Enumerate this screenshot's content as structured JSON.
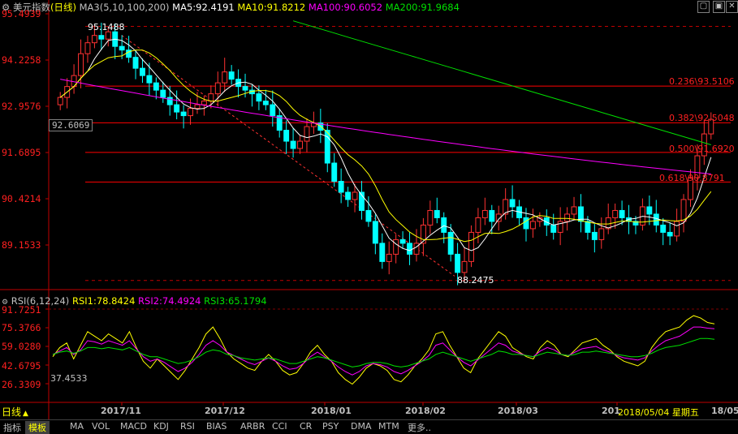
{
  "header": {
    "name": "美元指数",
    "period": "(日线)",
    "ma_label": "MA3(5,10,100,200)",
    "ma5": "MA5:92.4191",
    "ma10": "MA10:91.8212",
    "ma100": "MA100:90.6052",
    "ma200": "MA200:91.9684"
  },
  "rsi_header": {
    "label": "RSI(6,12,24)",
    "rsi1": "RSI1:78.8424",
    "rsi2": "RSI2:74.4924",
    "rsi3": "RSI3:65.1794"
  },
  "price_axis": [
    "95.4939",
    "94.2258",
    "92.9576",
    "91.6895",
    "90.4214",
    "89.1533"
  ],
  "rsi_axis": [
    "91.7251",
    "75.3766",
    "59.0280",
    "42.6795",
    "26.3309"
  ],
  "current_price_tag": "92.6069",
  "rsi_current_tag": "37.4533",
  "high_label": "95.1488",
  "low_label": "88.2475",
  "fib_labels": [
    "0.236\\93.5106",
    "0.382\\92.5048",
    "0.500\\91.6920",
    "0.618\\90.8791"
  ],
  "x_axis": [
    "2017/11",
    "2017/12",
    "2018/01",
    "2018/02",
    "2018/03",
    "2018/05/04 星期五"
  ],
  "x_axis_extra": [
    "201",
    "18/05"
  ],
  "bottom_bar": {
    "period_btn": "日线",
    "tabs": [
      "指标",
      "模板",
      "MA",
      "VOL",
      "MACD",
      "KDJ",
      "RSI",
      "BIAS",
      "ARBR",
      "CCI",
      "CR",
      "PSY",
      "DMA",
      "MTM",
      "更多.."
    ]
  },
  "colors": {
    "up": "#ff3232",
    "down": "#00ffff",
    "ma5": "#ffffff",
    "ma10": "#ffff00",
    "ma100": "#ff00ff",
    "ma200": "#00e000",
    "fib": "#ff0000"
  },
  "chart_data": [
    {
      "type": "candlestick",
      "title": "美元指数 (日线)",
      "x_ticks": [
        "2017/11",
        "2017/12",
        "2018/01",
        "2018/02",
        "2018/03"
      ],
      "ylim": [
        88.0,
        95.8
      ],
      "y_ticks": [
        95.4939,
        94.2258,
        92.9576,
        91.6895,
        90.4214,
        89.1533
      ],
      "fib_levels": [
        {
          "ratio": 0.236,
          "value": 93.5106
        },
        {
          "ratio": 0.382,
          "value": 92.5048
        },
        {
          "ratio": 0.5,
          "value": 91.692
        },
        {
          "ratio": 0.618,
          "value": 90.8791
        }
      ],
      "high": 95.1488,
      "low": 88.2475,
      "close_approx": [
        93.2,
        93.5,
        93.8,
        94.4,
        94.7,
        94.9,
        94.8,
        95.0,
        94.6,
        94.5,
        94.3,
        94.0,
        93.8,
        93.6,
        93.4,
        93.2,
        93.0,
        92.8,
        92.7,
        92.9,
        93.0,
        93.1,
        93.3,
        93.6,
        93.9,
        93.7,
        93.5,
        93.4,
        93.3,
        93.1,
        93.0,
        92.7,
        92.3,
        92.0,
        91.8,
        92.0,
        92.4,
        92.5,
        92.3,
        91.4,
        90.9,
        90.6,
        90.4,
        90.6,
        90.1,
        89.8,
        89.2,
        88.7,
        88.9,
        89.3,
        89.2,
        88.9,
        89.2,
        89.7,
        90.1,
        89.9,
        89.5,
        88.9,
        88.4,
        88.7,
        89.5,
        89.9,
        90.1,
        89.8,
        90.0,
        90.4,
        90.2,
        89.9,
        89.6,
        89.8,
        89.9,
        89.7,
        89.5,
        89.8,
        90.0,
        90.2,
        89.8,
        89.5,
        89.3,
        89.6,
        89.9,
        90.1,
        89.9,
        89.8,
        89.7,
        90.2,
        90.0,
        89.7,
        89.5,
        89.4,
        89.8,
        90.4,
        91.0,
        91.6,
        92.2,
        92.6
      ],
      "series": [
        {
          "name": "MA5",
          "last": 92.4191
        },
        {
          "name": "MA10",
          "last": 91.8212
        },
        {
          "name": "MA100",
          "last": 90.6052
        },
        {
          "name": "MA200",
          "last": 91.9684
        }
      ]
    },
    {
      "type": "line",
      "title": "RSI(6,12,24)",
      "ylim": [
        20,
        95
      ],
      "y_ticks": [
        91.7251,
        75.3766,
        59.028,
        42.6795,
        26.3309
      ],
      "series": [
        {
          "name": "RSI1",
          "last": 78.8424,
          "values": [
            50,
            58,
            62,
            48,
            60,
            72,
            68,
            64,
            70,
            66,
            62,
            72,
            58,
            46,
            40,
            48,
            42,
            36,
            30,
            38,
            48,
            58,
            70,
            76,
            66,
            54,
            48,
            44,
            40,
            38,
            46,
            52,
            46,
            38,
            34,
            36,
            44,
            54,
            60,
            52,
            46,
            36,
            30,
            26,
            32,
            40,
            44,
            42,
            38,
            30,
            28,
            34,
            42,
            48,
            56,
            70,
            72,
            60,
            50,
            40,
            36,
            48,
            56,
            64,
            72,
            68,
            58,
            54,
            50,
            48,
            58,
            64,
            60,
            52,
            50,
            56,
            62,
            64,
            66,
            60,
            56,
            50,
            46,
            44,
            42,
            46,
            58,
            66,
            72,
            74,
            76,
            82,
            86,
            84,
            80,
            78.8
          ]
        },
        {
          "name": "RSI2",
          "last": 74.4924,
          "values": [
            52,
            55,
            58,
            52,
            56,
            64,
            63,
            61,
            64,
            62,
            60,
            64,
            57,
            50,
            46,
            48,
            45,
            41,
            37,
            40,
            45,
            52,
            60,
            64,
            60,
            54,
            51,
            48,
            45,
            43,
            46,
            49,
            46,
            42,
            39,
            40,
            44,
            50,
            54,
            50,
            46,
            41,
            37,
            34,
            37,
            42,
            44,
            43,
            41,
            37,
            35,
            38,
            42,
            46,
            51,
            60,
            62,
            56,
            50,
            45,
            42,
            47,
            52,
            57,
            62,
            60,
            55,
            53,
            51,
            50,
            55,
            58,
            56,
            52,
            51,
            54,
            57,
            58,
            59,
            56,
            54,
            51,
            49,
            48,
            47,
            49,
            55,
            60,
            64,
            66,
            68,
            72,
            76,
            76,
            75,
            74.5
          ]
        },
        {
          "name": "RSI3",
          "last": 65.1794,
          "values": [
            52,
            54,
            55,
            53,
            55,
            58,
            58,
            57,
            58,
            57,
            56,
            58,
            55,
            52,
            50,
            50,
            48,
            46,
            44,
            45,
            47,
            50,
            54,
            56,
            55,
            52,
            51,
            49,
            48,
            47,
            48,
            49,
            48,
            46,
            44,
            44,
            46,
            48,
            50,
            49,
            47,
            45,
            43,
            41,
            42,
            44,
            45,
            45,
            44,
            42,
            41,
            42,
            44,
            46,
            48,
            52,
            54,
            52,
            50,
            48,
            46,
            48,
            50,
            52,
            55,
            54,
            52,
            52,
            51,
            50,
            52,
            54,
            53,
            52,
            51,
            52,
            54,
            54,
            55,
            54,
            53,
            52,
            51,
            50,
            50,
            51,
            53,
            56,
            58,
            59,
            60,
            62,
            64,
            66,
            66,
            65.2
          ]
        }
      ]
    }
  ]
}
